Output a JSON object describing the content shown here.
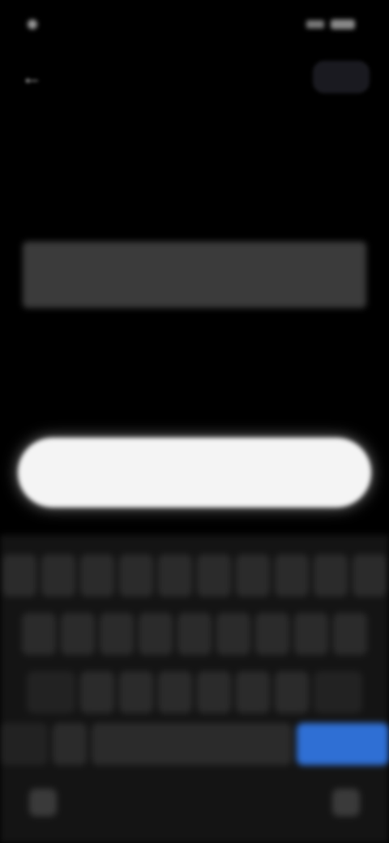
{
  "status_bar": {
    "time": "",
    "battery": ""
  },
  "header": {
    "back_icon": "arrow-left-icon",
    "help_label": ""
  },
  "title": "",
  "input": {
    "value": "",
    "placeholder": ""
  },
  "continue_button": {
    "label": ""
  },
  "keyboard": {
    "row1": [
      "",
      "",
      "",
      "",
      "",
      "",
      "",
      "",
      "",
      ""
    ],
    "row2": [
      "",
      "",
      "",
      "",
      "",
      "",
      "",
      "",
      ""
    ],
    "row3": [
      "",
      "",
      "",
      "",
      "",
      "",
      "",
      ""
    ],
    "row4": [
      "",
      "",
      "",
      ""
    ],
    "enter_label": ""
  },
  "colors": {
    "background": "#000000",
    "input": "#3b3b3b",
    "button": "#f4f4f4",
    "keyboard": "#141414",
    "enter_key": "#2f6fd4"
  }
}
